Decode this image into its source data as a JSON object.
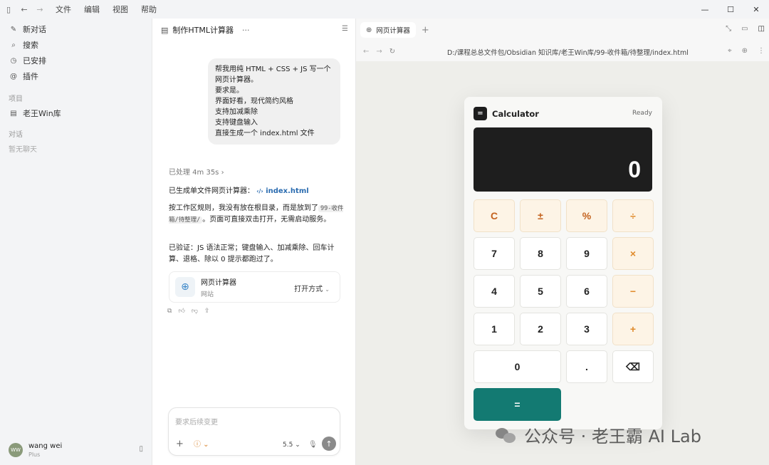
{
  "titlebar": {
    "menu": [
      "文件",
      "编辑",
      "视图",
      "帮助"
    ]
  },
  "sidebar": {
    "items": [
      {
        "label": "新对话",
        "icon": "edit-icon"
      },
      {
        "label": "搜索",
        "icon": "search-icon"
      },
      {
        "label": "已安排",
        "icon": "clock-icon"
      },
      {
        "label": "插件",
        "icon": "plugin-icon"
      }
    ],
    "projects_label": "项目",
    "projects": [
      {
        "label": "老王Win库"
      }
    ],
    "chats_label": "对话",
    "chats_empty": "暂无聊天",
    "user": {
      "initials": "WW",
      "name": "wang wei",
      "plan": "Plus"
    }
  },
  "chat": {
    "title": "制作HTML计算器",
    "user_message": [
      "帮我用纯 HTML + CSS + JS 写一个网页计算器。",
      "要求是。",
      "界面好看，现代简约风格",
      "支持加减乘除",
      "支持键盘输入",
      "直接生成一个 index.html 文件"
    ],
    "processed": "已处理 4m 35s",
    "reply1_prefix": "已生成单文件网页计算器：",
    "reply1_link": "index.html",
    "reply2_a": "按工作区规则，我没有放在根目录，而是放到了",
    "reply2_code": "99-收件箱/待整理/",
    "reply2_b": "。页面可直接双击打开，无需启动服务。",
    "reply3": "已验证：JS 语法正常；键盘输入、加减乘除、回车计算、退格、除以 0 提示都跑过了。",
    "card": {
      "title": "网页计算器",
      "subtitle": "网站",
      "open_label": "打开方式"
    },
    "composer": {
      "placeholder": "要求后续变更",
      "model": "5.5"
    }
  },
  "browser": {
    "tab_title": "网页计算器",
    "url": "D:/课程总总文件包/Obsidian 知识库/老王Win库/99-收件箱/待整理/index.html"
  },
  "calculator": {
    "title": "Calculator",
    "status": "Ready",
    "display": "0",
    "keys": {
      "clear": "C",
      "sign": "±",
      "percent": "%",
      "divide": "÷",
      "k7": "7",
      "k8": "8",
      "k9": "9",
      "multiply": "×",
      "k4": "4",
      "k5": "5",
      "k6": "6",
      "minus": "−",
      "k1": "1",
      "k2": "2",
      "k3": "3",
      "plus": "+",
      "k0": "0",
      "dot": ".",
      "backspace": "⌫",
      "equals": "="
    }
  },
  "watermark": "公众号 · 老王霸 AI Lab"
}
